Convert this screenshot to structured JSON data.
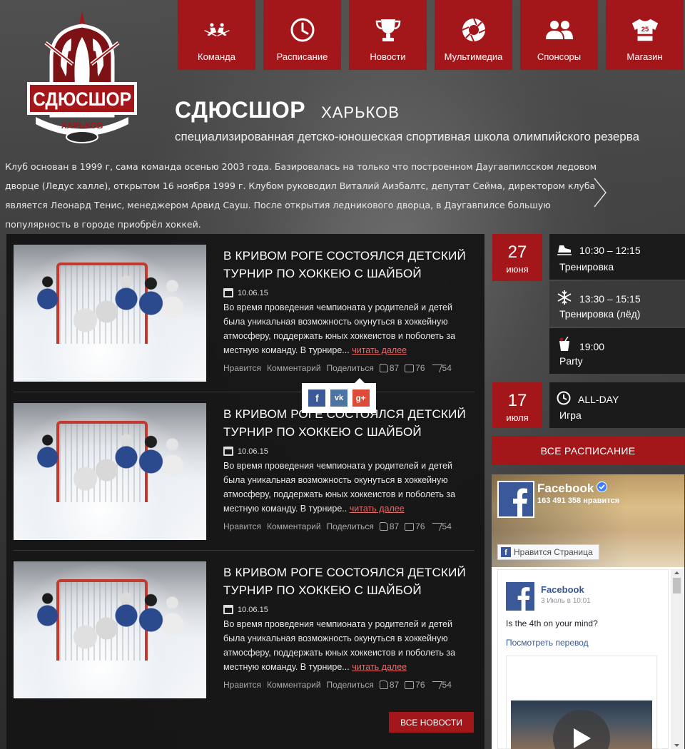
{
  "nav": [
    {
      "label": "Команда",
      "icon": "hockey-players-icon"
    },
    {
      "label": "Расписание",
      "icon": "clock-icon"
    },
    {
      "label": "Новости",
      "icon": "trophy-icon"
    },
    {
      "label": "Мультимедиа",
      "icon": "camera-aperture-icon"
    },
    {
      "label": "Спонсоры",
      "icon": "people-icon"
    },
    {
      "label": "Магазин",
      "icon": "jersey-icon"
    }
  ],
  "logo": {
    "main": "СДЮСШОР",
    "city": "ХАРЬКОВ",
    "jersey_number": "25"
  },
  "header": {
    "title": "СДЮСШОР",
    "city": "ХАРЬКОВ",
    "subtitle": "специализированная детско-юношеская спортивная школа олимпийского резерва",
    "intro": "Клуб основан в 1999 г, сама команда осенью 2003 года. Базировалась на только что построенном Даугавпилсском ледовом дворце (Ледус халле), открытом 16 ноября 1999 г. Клубом руководил Виталий Аизбалтс, депутат Сейма, директором клуба является Леонард Тенис, менеджером Арвид Сауш. После открытия ледникового дворца, в Даугавпилсе большую популярность в городе приобрёл хоккей."
  },
  "news": {
    "articles": [
      {
        "title": "В КРИВОМ РОГЕ СОСТОЯЛСЯ ДЕТСКИЙ ТУРНИР ПО ХОККЕЮ С ШАЙБОЙ",
        "date": "10.06.15",
        "text": "Во время проведения чемпионата у родителей и детей была уникальная возможность окунуться в хоккейную атмосферу, поддержать юных хоккеистов и поболеть за местную команду. В турнире...",
        "more": "читать далее",
        "like": "Нравится",
        "comment": "Комментарий",
        "share": "Поделиться",
        "likes": "87",
        "comments": "76",
        "shares": "54"
      },
      {
        "title": "В КРИВОМ РОГЕ СОСТОЯЛСЯ ДЕТСКИЙ ТУРНИР ПО ХОККЕЮ С ШАЙБОЙ",
        "date": "10.06.15",
        "text": "Во время проведения чемпионата у родителей и детей была уникальная возможность окунуться в хоккейную атмосферу, поддержать юных хоккеистов и поболеть за местную команду. В турнире..",
        "more": "читать далее",
        "like": "Нравится",
        "comment": "Комментарий",
        "share": "Поделиться",
        "likes": "87",
        "comments": "76",
        "shares": "54"
      },
      {
        "title": "В КРИВОМ РОГЕ СОСТОЯЛСЯ ДЕТСКИЙ ТУРНИР ПО ХОККЕЮ С ШАЙБОЙ",
        "date": "10.06.15",
        "text": "Во время проведения чемпионата у родителей и детей была уникальная возможность окунуться в хоккейную атмосферу, поддержать юных хоккеистов и поболеть за местную команду. В турнире...",
        "more": "читать далее",
        "like": "Нравится",
        "comment": "Комментарий",
        "share": "Поделиться",
        "likes": "87",
        "comments": "76",
        "shares": "54"
      }
    ],
    "all_button": "ВСЕ НОВОСТИ",
    "share_popup": [
      "facebook-icon",
      "vk-icon",
      "google-plus-icon"
    ]
  },
  "schedule": {
    "days": [
      {
        "day": "27",
        "month": "июня",
        "events": [
          {
            "time": "10:30 – 12:15",
            "name": "Тренировка",
            "icon": "skate-icon"
          },
          {
            "time": "13:30 – 15:15",
            "name": "Тренировка (лёд)",
            "icon": "snowflake-icon"
          },
          {
            "time": "19:00",
            "name": "Party",
            "icon": "cocktail-icon"
          }
        ]
      },
      {
        "day": "17",
        "month": "июля",
        "events": [
          {
            "time": "ALL-DAY",
            "name": "Игра",
            "icon": "clock-icon"
          }
        ]
      }
    ],
    "all_button": "ВСЕ РАСПИСАНИЕ"
  },
  "facebook": {
    "page_name": "Facebook",
    "likes": "163 491 358 нравится",
    "like_button": "Нравится Страница",
    "post": {
      "author": "Facebook",
      "time": "3 Июль в 10:01",
      "text": "Is the 4th on your mind?",
      "translate": "Посмотреть перевод"
    }
  },
  "colors": {
    "accent": "#a3171b",
    "panel": "#161616",
    "link": "#e06a6a",
    "fb_blue": "#3b5998"
  }
}
